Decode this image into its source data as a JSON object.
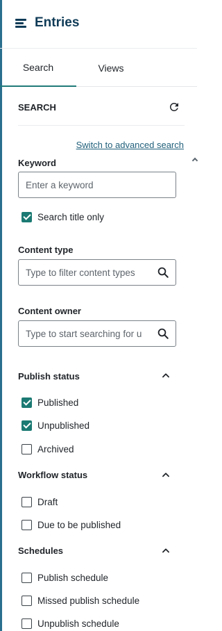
{
  "header": {
    "title": "Entries",
    "menu_icon": "hamburger-menu-icon"
  },
  "tabs": [
    {
      "label": "Search",
      "active": true
    },
    {
      "label": "Views",
      "active": false
    }
  ],
  "search": {
    "title": "SEARCH",
    "refresh_icon": "refresh-icon",
    "advanced_link": "Switch to advanced search",
    "keyword": {
      "label": "Keyword",
      "placeholder": "Enter a keyword",
      "value": ""
    },
    "title_only": {
      "label": "Search title only",
      "checked": true
    },
    "content_type": {
      "label": "Content type",
      "placeholder": "Type to filter content types",
      "value": ""
    },
    "content_owner": {
      "label": "Content owner",
      "placeholder": "Type to start searching for u",
      "value": ""
    }
  },
  "filters": {
    "publish_status": {
      "title": "Publish status",
      "expanded": true,
      "options": [
        {
          "label": "Published",
          "checked": true
        },
        {
          "label": "Unpublished",
          "checked": true
        },
        {
          "label": "Archived",
          "checked": false
        }
      ]
    },
    "workflow_status": {
      "title": "Workflow status",
      "expanded": true,
      "options": [
        {
          "label": "Draft",
          "checked": false
        },
        {
          "label": "Due to be published",
          "checked": false
        }
      ]
    },
    "schedules": {
      "title": "Schedules",
      "expanded": true,
      "options": [
        {
          "label": "Publish schedule",
          "checked": false
        },
        {
          "label": "Missed publish schedule",
          "checked": false
        },
        {
          "label": "Unpublish schedule",
          "checked": false
        }
      ]
    }
  },
  "colors": {
    "brand_dark": "#0f3b57",
    "accent_teal": "#1b7a73",
    "link": "#1f5f7a"
  }
}
